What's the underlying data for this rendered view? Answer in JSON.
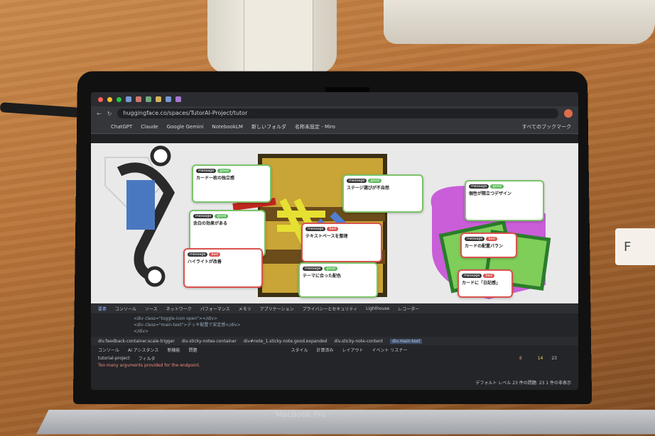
{
  "browser": {
    "url": "huggingface.co/spaces/TutorAI-Project/tutor",
    "bookmarks": [
      "ChatGPT",
      "Claude",
      "Google Gemini",
      "NotebookLM",
      "新しいフォルダ",
      "名称未設定 - Miro"
    ],
    "all_bookmarks": "すべてのブックマーク"
  },
  "stickies": [
    {
      "title": "カード一枚の独立感",
      "status": "good"
    },
    {
      "title": "ステージ選びが不自然",
      "status": "good"
    },
    {
      "title": "個性が際立つデザイン",
      "status": "good"
    },
    {
      "title": "余白の効果がある",
      "status": "good"
    },
    {
      "title": "テキストベースを整理",
      "status": "bad"
    },
    {
      "title": "カードの配置バラン",
      "status": "bad"
    },
    {
      "title": "ハイライトが改善",
      "status": "bad"
    },
    {
      "title": "テーマに合った配色",
      "status": "good"
    },
    {
      "title": "カードに「日記感」",
      "status": "bad"
    }
  ],
  "devtools": {
    "tabs": [
      "要素",
      "コンソール",
      "ソース",
      "ネットワーク",
      "パフォーマンス",
      "メモリ",
      "アプリケーション",
      "プライバシーとセキュリティ",
      "Lighthouse",
      "レコーダー"
    ],
    "code_lines": [
      "<div class=\"toggle-icon open\"></div>",
      "<div class=\"main-text\">デッキ配置で安定感</div>",
      "</div>"
    ],
    "crumbs": [
      "div.feedback-container.scale-trigger",
      "div.sticky-notes-container",
      "div#note_1.sticky-note.good.expanded",
      "div.sticky-note-content",
      "div.main-text"
    ],
    "side_tabs": [
      "スタイル",
      "計算済み",
      "レイアウト",
      "イベント リスナー"
    ],
    "console_tab": "コンソール",
    "ai_tab": "AI アシスタンス",
    "whatsnew_tab": "新機能",
    "issues_tab": "問題",
    "filter": "フィルタ",
    "context": "tutorial-project",
    "error": "Too many arguments provided for the endpoint.",
    "level": "デフォルト レベル",
    "issues": "23 件の問題: 23",
    "hidden": "1 件の非表示",
    "counts": {
      "errors": "8",
      "warnings": "14",
      "issues": "23"
    }
  },
  "laptop": {
    "brand": "MacBook Pro"
  },
  "desk_card": "F"
}
